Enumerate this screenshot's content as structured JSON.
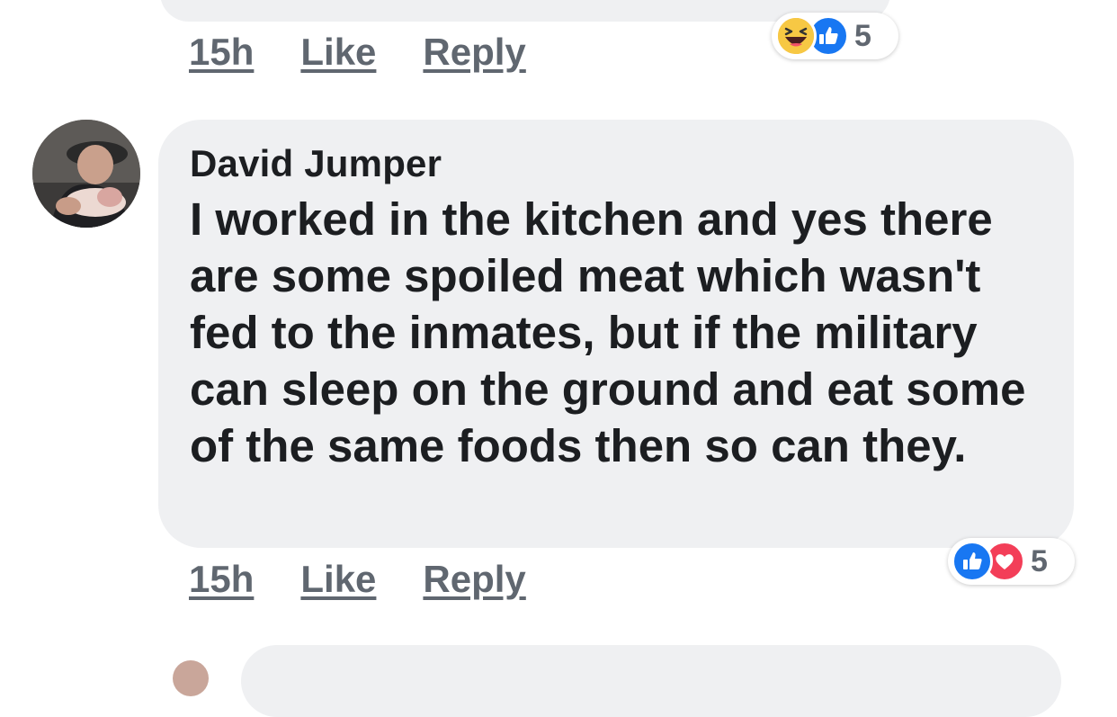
{
  "previous_comment": {
    "timestamp": "15h",
    "like_label": "Like",
    "reply_label": "Reply",
    "reactions": {
      "icons": [
        "haha-icon",
        "like-icon"
      ],
      "count": "5"
    }
  },
  "comment": {
    "author": "David Jumper",
    "text": "I worked in the kitchen and yes there are some spoiled meat which wasn't fed to the inmates, but if the military can sleep on the ground and eat some of the same foods then so can they.",
    "timestamp": "15h",
    "like_label": "Like",
    "reply_label": "Reply",
    "reactions": {
      "icons": [
        "like-icon",
        "love-icon"
      ],
      "count": "5"
    }
  },
  "colors": {
    "bubble": "#eff0f2",
    "text": "#1c1e21",
    "meta_text": "#606770",
    "like_blue": "#1877f2",
    "love_red": "#f33e58",
    "haha_yellow": "#f7b125"
  }
}
